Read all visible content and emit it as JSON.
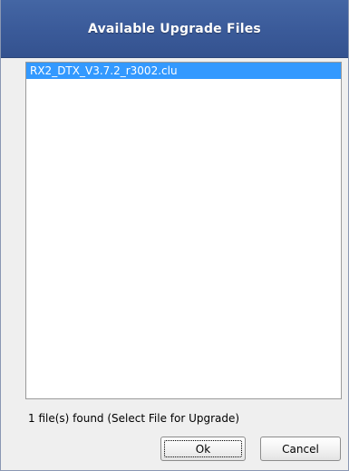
{
  "dialog": {
    "title": "Available Upgrade Files"
  },
  "file_list": {
    "items": [
      {
        "name": "RX2_DTX_V3.7.2_r3002.clu",
        "selected": true
      }
    ]
  },
  "status_text": "1 file(s) found (Select File for Upgrade)",
  "buttons": {
    "ok_label": "Ok",
    "cancel_label": "Cancel"
  },
  "colors": {
    "title_bar": "#3b5b9a",
    "selection": "#3399ff",
    "dialog_background": "#efefef"
  }
}
